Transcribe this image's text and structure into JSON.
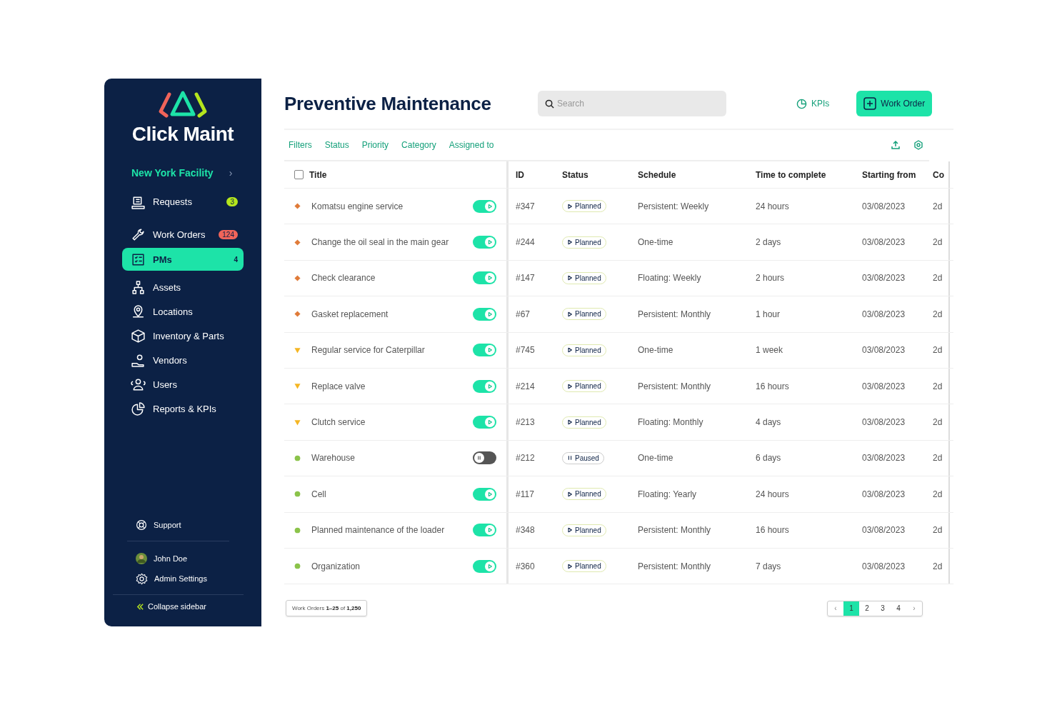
{
  "sidebar": {
    "brand": "Click Maint",
    "facility": "New York Facility",
    "facility_chevron": "›",
    "items": [
      {
        "label": "Requests",
        "selected": false,
        "badge": "3",
        "color": "#b5e61d"
      },
      {
        "label": "Work Orders",
        "selected": false,
        "badge": "124",
        "color": "#f0645a"
      },
      {
        "label": "PMs",
        "selected": true,
        "badge": "4"
      },
      {
        "label": "Assets",
        "selected": false
      },
      {
        "label": "Locations",
        "selected": false
      },
      {
        "label": "Inventory & Parts",
        "selected": false
      },
      {
        "label": "Vendors",
        "selected": false
      },
      {
        "label": "Users",
        "selected": false
      },
      {
        "label": "Reports & KPIs",
        "selected": false
      }
    ],
    "support": "Support",
    "user": "John Doe",
    "admin": "Admin Settings",
    "collapse": "Collapse sidebar"
  },
  "header": {
    "title": "Preventive Maintenance",
    "search": {
      "placeholder": "Search"
    },
    "kpis": "KPIs",
    "work_order": "Work Order"
  },
  "filters": [
    "Filters",
    "Status",
    "Priority",
    "Category",
    "Assigned to"
  ],
  "table": {
    "select_all": {
      "checked": false
    },
    "columns": [
      "Title",
      "ID",
      "Status",
      "Schedule",
      "Time to complete",
      "Starting from",
      "Co"
    ],
    "rows": [
      {
        "marker": {
          "kind": "diamond",
          "color": "#e07b39"
        },
        "title": "Komatsu engine service",
        "on": true,
        "id": "#347",
        "status": {
          "kind": "planned",
          "label": "Planned"
        },
        "schedule": "Persistent: Weekly",
        "time": "24 hours",
        "start": "03/08/2023",
        "column_7": "2d"
      },
      {
        "marker": {
          "kind": "diamond",
          "color": "#e07b39"
        },
        "title": "Change the oil seal in the main gear",
        "on": true,
        "id": "#244",
        "status": {
          "kind": "planned",
          "label": "Planned"
        },
        "schedule": "One-time",
        "time": "2 days",
        "start": "03/08/2023",
        "column_7": "2d"
      },
      {
        "marker": {
          "kind": "diamond",
          "color": "#e07b39"
        },
        "title": "Check clearance",
        "on": true,
        "id": "#147",
        "status": {
          "kind": "planned",
          "label": "Planned"
        },
        "schedule": "Floating: Weekly",
        "time": "2 hours",
        "start": "03/08/2023",
        "column_7": "2d"
      },
      {
        "marker": {
          "kind": "diamond",
          "color": "#e07b39"
        },
        "title": "Gasket replacement",
        "on": true,
        "id": "#67",
        "status": {
          "kind": "planned",
          "label": "Planned"
        },
        "schedule": "Persistent: Monthly",
        "time": "1 hour",
        "start": "03/08/2023",
        "column_7": "2d"
      },
      {
        "marker": {
          "kind": "triangle",
          "color": "#f5b623"
        },
        "title": "Regular service for Caterpillar",
        "on": true,
        "id": "#745",
        "status": {
          "kind": "planned",
          "label": "Planned"
        },
        "schedule": "One-time",
        "time": "1 week",
        "start": "03/08/2023",
        "column_7": "2d"
      },
      {
        "marker": {
          "kind": "triangle",
          "color": "#f5b623"
        },
        "title": "Replace valve",
        "on": true,
        "id": "#214",
        "status": {
          "kind": "planned",
          "label": "Planned"
        },
        "schedule": "Persistent: Monthly",
        "time": "16 hours",
        "start": "03/08/2023",
        "column_7": "2d"
      },
      {
        "marker": {
          "kind": "triangle",
          "color": "#f5b623"
        },
        "title": "Clutch service",
        "on": true,
        "id": "#213",
        "status": {
          "kind": "planned",
          "label": "Planned"
        },
        "schedule": "Floating: Monthly",
        "time": "4 days",
        "start": "03/08/2023",
        "column_7": "2d"
      },
      {
        "marker": {
          "kind": "dot",
          "color": "#8bc34a"
        },
        "title": "Warehouse",
        "on": false,
        "id": "#212",
        "status": {
          "kind": "paused",
          "label": "Paused"
        },
        "schedule": "One-time",
        "time": "6 days",
        "start": "03/08/2023",
        "column_7": "2d"
      },
      {
        "marker": {
          "kind": "dot",
          "color": "#8bc34a"
        },
        "title": "Cell",
        "on": true,
        "id": "#117",
        "status": {
          "kind": "planned",
          "label": "Planned"
        },
        "schedule": "Floating: Yearly",
        "time": "24 hours",
        "start": "03/08/2023",
        "column_7": "2d"
      },
      {
        "marker": {
          "kind": "dot",
          "color": "#8bc34a"
        },
        "title": "Planned maintenance of the loader",
        "on": true,
        "id": "#348",
        "status": {
          "kind": "planned",
          "label": "Planned"
        },
        "schedule": "Persistent: Monthly",
        "time": "16 hours",
        "start": "03/08/2023",
        "column_7": "2d"
      },
      {
        "marker": {
          "kind": "dot",
          "color": "#8bc34a"
        },
        "title": "Organization",
        "on": true,
        "id": "#360",
        "status": {
          "kind": "planned",
          "label": "Planned"
        },
        "schedule": "Persistent: Monthly",
        "time": "7 days",
        "start": "03/08/2023",
        "column_7": "2d"
      }
    ]
  },
  "footer": {
    "count": "Work Orders **1–25** of **1,250**",
    "prev": "‹",
    "pages": [
      {
        "label": "1",
        "selected": true
      },
      {
        "label": "2",
        "selected": false
      },
      {
        "label": "3",
        "selected": false
      },
      {
        "label": "4",
        "selected": false
      }
    ],
    "next": "›"
  }
}
